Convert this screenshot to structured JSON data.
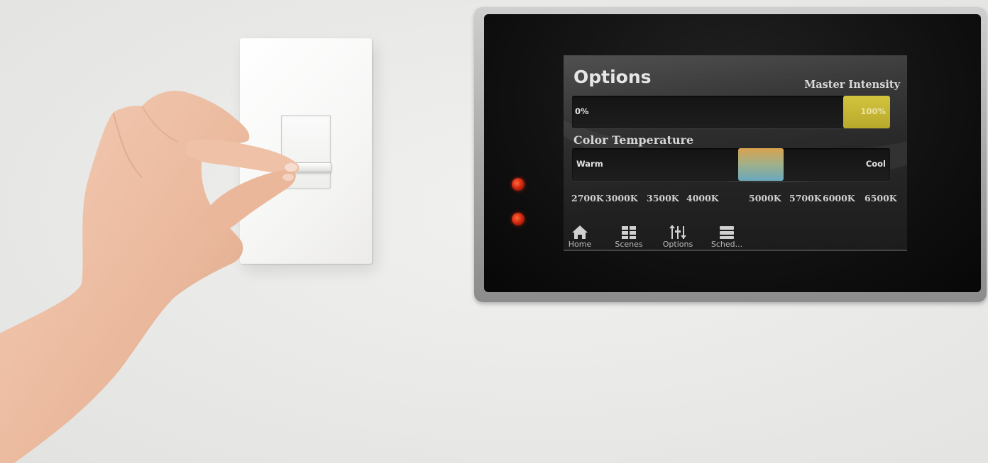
{
  "options_screen": {
    "title": "Options",
    "master_intensity": {
      "label": "Master Intensity",
      "min_label": "0%",
      "max_label": "100%",
      "level_percent": 100,
      "thumb_color": "#c9bb36"
    },
    "color_temperature": {
      "label": "Color Temperature",
      "warm_label": "Warm",
      "cool_label": "Cool",
      "kelvin_ticks": [
        "2700K",
        "3000K",
        "3500K",
        "4000K",
        "5000K",
        "5700K",
        "6000K",
        "6500K"
      ],
      "selected_kelvin": "4000K-5000K"
    },
    "nav": [
      {
        "label": "Home",
        "icon": "home-icon"
      },
      {
        "label": "Scenes",
        "icon": "grid-icon"
      },
      {
        "label": "Options",
        "icon": "sliders-icon"
      },
      {
        "label": "Sched...",
        "icon": "list-icon"
      }
    ]
  },
  "indicator_leds": {
    "count": 2,
    "color": "#d42a10"
  }
}
